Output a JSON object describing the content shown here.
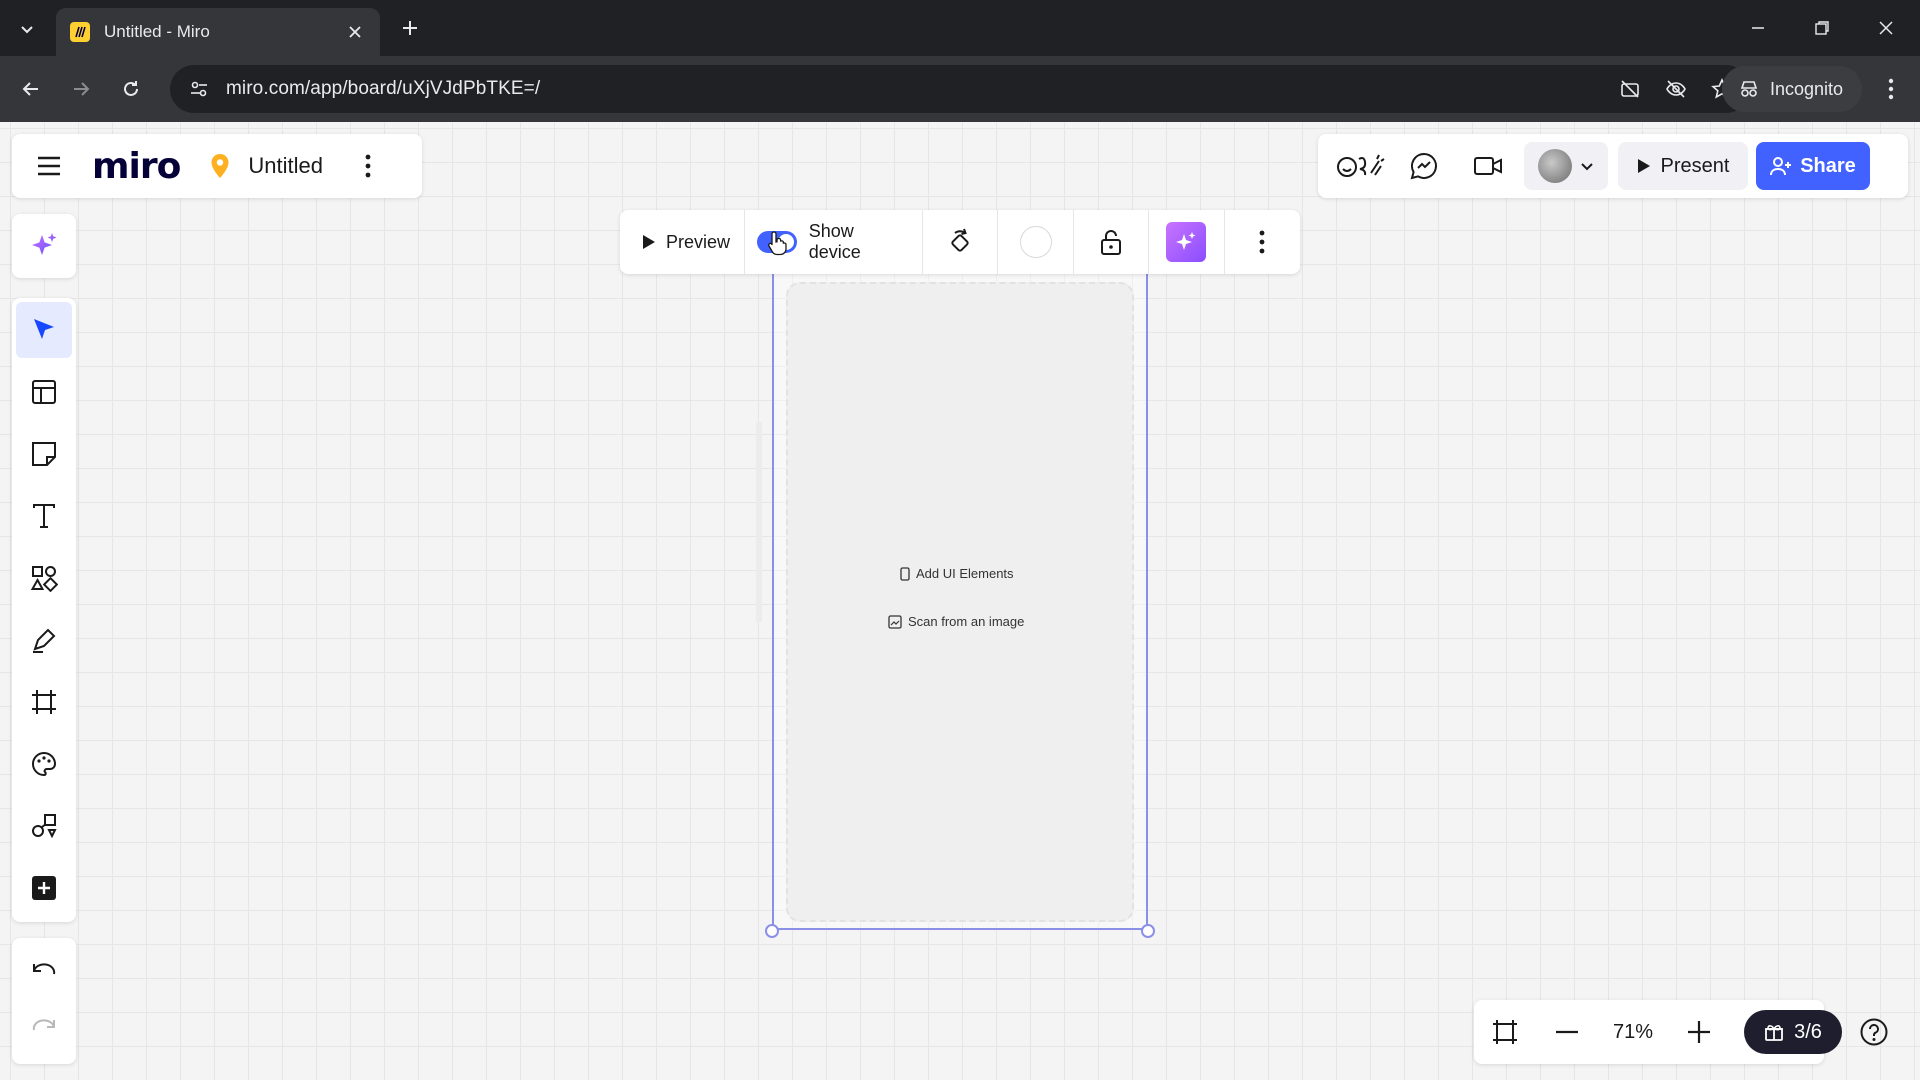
{
  "browser": {
    "tab_title": "Untitled - Miro",
    "url": "miro.com/app/board/uXjVJdPbTKE=/",
    "incognito_label": "Incognito"
  },
  "board": {
    "logo": "miro",
    "title": "Untitled"
  },
  "header_right": {
    "present_label": "Present",
    "share_label": "Share"
  },
  "context_toolbar": {
    "preview_label": "Preview",
    "show_device_label": "Show device",
    "show_device_on": true
  },
  "frame": {
    "add_ui_label": "Add UI Elements",
    "scan_label": "Scan from an image"
  },
  "zoom": {
    "level": "71%",
    "pages": "3/6"
  },
  "colors": {
    "accent": "#4262ff",
    "frame_border": "#8a8fe8",
    "ai_gradient_start": "#c874ff",
    "ai_gradient_end": "#8a4dff"
  }
}
